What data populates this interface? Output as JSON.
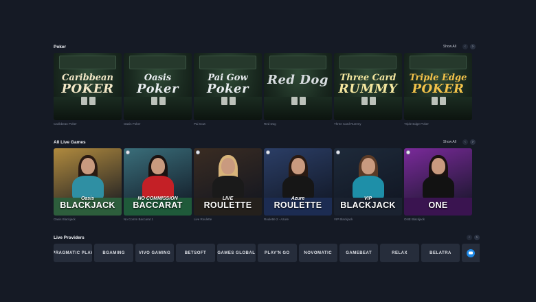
{
  "poker": {
    "title": "Poker",
    "show_all": "Show All",
    "prev": "‹",
    "next": "›",
    "games": [
      {
        "caption": "Caribbean Poker",
        "logo_l1": "Caribbean",
        "logo_l2": "POKER",
        "color": "#f3e8c8"
      },
      {
        "caption": "Oasis Poker",
        "logo_l1": "Oasis",
        "logo_l2": "Poker",
        "color": "#e8ecef"
      },
      {
        "caption": "Pai Gow",
        "logo_l1": "Pai Gow",
        "logo_l2": "Poker",
        "color": "#e8ecef"
      },
      {
        "caption": "Red Dog",
        "logo_l1": "",
        "logo_l2": "Red Dog",
        "color": "#d8dde0"
      },
      {
        "caption": "Three Card Rummy",
        "logo_l1": "Three Card",
        "logo_l2": "RUMMY",
        "color": "#f4e7a0"
      },
      {
        "caption": "Triple Edge Poker",
        "logo_l1": "Triple Edge",
        "logo_l2": "POKER",
        "color": "#f2c24a"
      }
    ]
  },
  "live": {
    "title": "All Live Games",
    "show_all": "Show All",
    "prev": "‹",
    "next": "›",
    "games": [
      {
        "caption": "Oasis Blackjack",
        "top": "Oasis",
        "main": "BLACKJACK",
        "bg": "#b08a3e",
        "felt": "#2d5e3c",
        "hair": "#2a1a12",
        "body": "#2f8fa3",
        "badge": false
      },
      {
        "caption": "No Comm Baccarat 1",
        "top": "NO COMMISSION",
        "main": "BACCARAT",
        "bg": "#3a6e7a",
        "felt": "#1f5a3a",
        "hair": "#1b1210",
        "body": "#c42026",
        "badge": true
      },
      {
        "caption": "Live Roulette",
        "top": "LIVE",
        "main": "ROULETTE",
        "bg": "#3a2c22",
        "felt": "#24201c",
        "hair": "#d8b47a",
        "body": "#1a1a1a",
        "badge": true
      },
      {
        "caption": "Roulette 2 - Azure",
        "top": "Azure",
        "main": "ROULETTE",
        "bg": "#2b3e66",
        "felt": "#1c2c52",
        "hair": "#2a1a12",
        "body": "#161616",
        "badge": true
      },
      {
        "caption": "VIP Blackjack",
        "top": "VIP",
        "main": "BLACKJACK",
        "bg": "#1e2a3a",
        "felt": "#1a2230",
        "hair": "#5a3a26",
        "body": "#1e8fa8",
        "badge": true
      },
      {
        "caption": "ONE Blackjack",
        "top": "",
        "main": "ONE",
        "bg": "#7a2a9a",
        "felt": "#3a1450",
        "hair": "#1b1210",
        "body": "#121212",
        "badge": true
      }
    ]
  },
  "providers": {
    "title": "Live Providers",
    "prev": "‹",
    "next": "›",
    "items": [
      {
        "label": "PRAGMATIC PLAY"
      },
      {
        "label": "BGAMING"
      },
      {
        "label": "VIVO GAMING"
      },
      {
        "label": "BETSOFT"
      },
      {
        "label": "GAMES GLOBAL"
      },
      {
        "label": "PLAY'N GO"
      },
      {
        "label": "NOVOMATIC"
      },
      {
        "label": "GAMEBEAT"
      },
      {
        "label": "RELAX"
      },
      {
        "label": "BELATRA"
      }
    ],
    "chat_icon": "chat-icon"
  }
}
